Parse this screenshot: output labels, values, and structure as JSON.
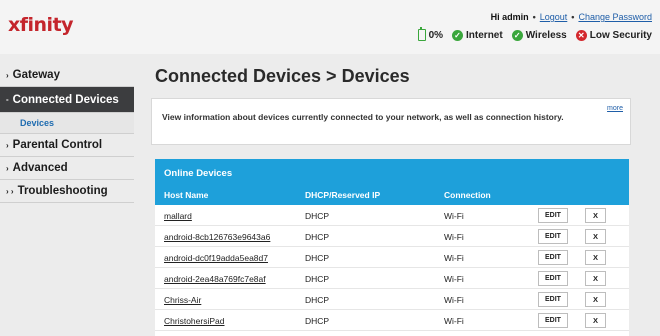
{
  "brand": {
    "logo": "xfinity",
    "accent": "#c4252c",
    "blue": "#1ea0da"
  },
  "header": {
    "greeting": "Hi admin",
    "logout": "Logout",
    "change_password": "Change Password",
    "status": {
      "battery": "0%",
      "internet": "Internet",
      "wireless": "Wireless",
      "security": "Low Security"
    }
  },
  "sidebar": {
    "items": [
      {
        "label": "Gateway",
        "arrow": "›"
      },
      {
        "label": "Connected Devices",
        "arrow": "-"
      },
      {
        "label": "Devices"
      },
      {
        "label": "Parental Control",
        "arrow": "›"
      },
      {
        "label": "Advanced",
        "arrow": "›"
      },
      {
        "label": "Troubleshooting",
        "arrow": "› ›"
      }
    ]
  },
  "main": {
    "title": "Connected Devices > Devices",
    "info": "View information about devices currently connected to your network, as well as connection history.",
    "more": "more",
    "online": {
      "title": "Online Devices",
      "columns": [
        "Host Name",
        "DHCP/Reserved IP",
        "Connection"
      ],
      "edit_label": "EDIT",
      "remove_label": "X",
      "rows": [
        {
          "host": "mallard",
          "ip": "DHCP",
          "conn": "Wi-Fi"
        },
        {
          "host": "android-8cb126763e9643a6",
          "ip": "DHCP",
          "conn": "Wi-Fi"
        },
        {
          "host": "android-dc0f19adda5ea8d7",
          "ip": "DHCP",
          "conn": "Wi-Fi"
        },
        {
          "host": "android-2ea48a769fc7e8af",
          "ip": "DHCP",
          "conn": "Wi-Fi"
        },
        {
          "host": "Chriss-Air",
          "ip": "DHCP",
          "conn": "Wi-Fi"
        },
        {
          "host": "ChristohersiPad",
          "ip": "DHCP",
          "conn": "Wi-Fi"
        }
      ]
    }
  }
}
